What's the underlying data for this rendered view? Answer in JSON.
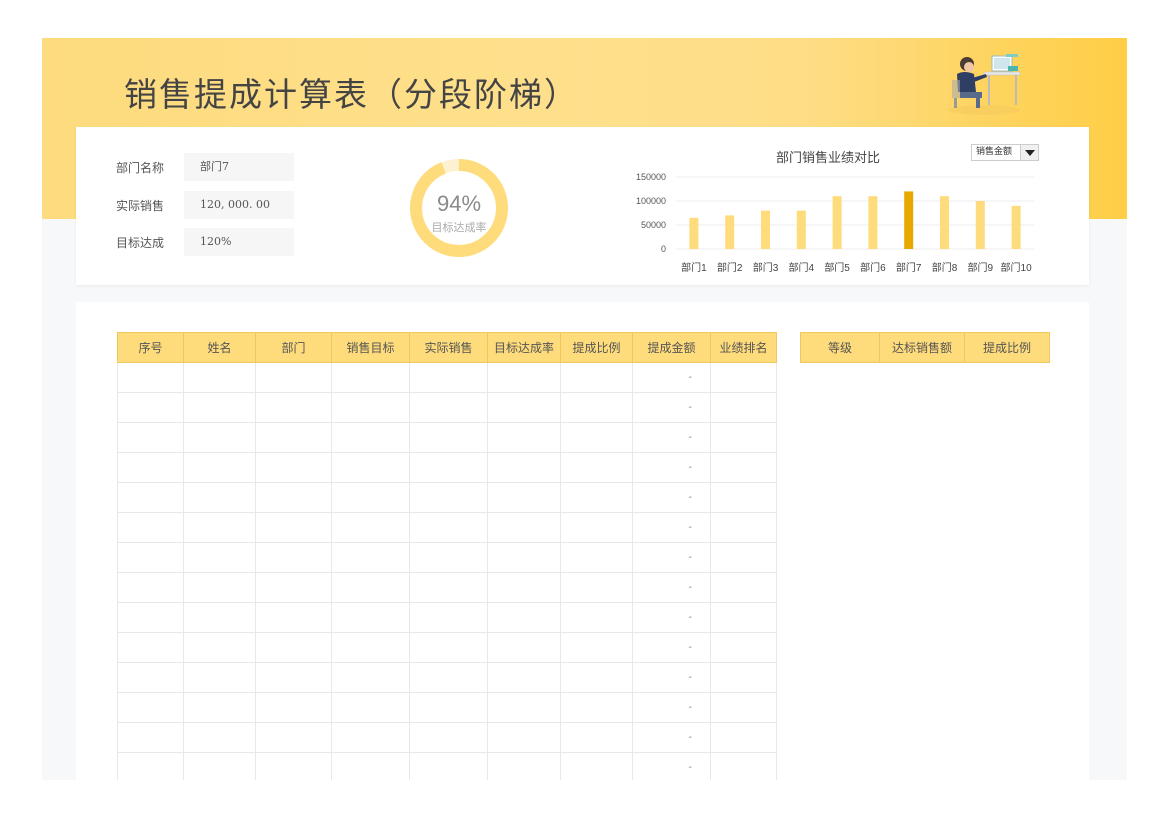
{
  "title": "销售提成计算表（分段阶梯）",
  "colors": {
    "accent": "#fedb7b",
    "bar": "#fedb7b",
    "bar_highlight": "#e8a800",
    "donut": "#fedb7b",
    "donut_rest": "#fdf1d2"
  },
  "info": {
    "dept_label": "部门名称",
    "dept_value": "部门7",
    "sales_label": "实际销售",
    "sales_value": "120, 000. 00",
    "rate_label": "目标达成",
    "rate_value": "120%"
  },
  "donut": {
    "percent_text": "94%",
    "percent_value": 0.94,
    "label": "目标达成率"
  },
  "chart_select": {
    "value": "销售金额"
  },
  "chart_data": {
    "type": "bar",
    "title": "部门销售业绩对比",
    "categories": [
      "部门1",
      "部门2",
      "部门3",
      "部门4",
      "部门5",
      "部门6",
      "部门7",
      "部门8",
      "部门9",
      "部门10"
    ],
    "values": [
      65000,
      70000,
      80000,
      80000,
      110000,
      110000,
      120000,
      110000,
      100000,
      90000
    ],
    "highlight": "部门7",
    "ylim": [
      0,
      150000
    ],
    "yticks": [
      "150000",
      "100000",
      "50000",
      "0"
    ],
    "xlabel": "",
    "ylabel": "",
    "grid": true
  },
  "main_table": {
    "headers": [
      "序号",
      "姓名",
      "部门",
      "销售目标",
      "实际销售",
      "目标达成率",
      "提成比例",
      "提成金额",
      "业绩排名"
    ],
    "rows": [
      [
        "",
        "",
        "",
        "",
        "",
        "",
        "",
        "-",
        ""
      ],
      [
        "",
        "",
        "",
        "",
        "",
        "",
        "",
        "-",
        ""
      ],
      [
        "",
        "",
        "",
        "",
        "",
        "",
        "",
        "-",
        ""
      ],
      [
        "",
        "",
        "",
        "",
        "",
        "",
        "",
        "-",
        ""
      ],
      [
        "",
        "",
        "",
        "",
        "",
        "",
        "",
        "-",
        ""
      ],
      [
        "",
        "",
        "",
        "",
        "",
        "",
        "",
        "-",
        ""
      ],
      [
        "",
        "",
        "",
        "",
        "",
        "",
        "",
        "-",
        ""
      ],
      [
        "",
        "",
        "",
        "",
        "",
        "",
        "",
        "-",
        ""
      ],
      [
        "",
        "",
        "",
        "",
        "",
        "",
        "",
        "-",
        ""
      ],
      [
        "",
        "",
        "",
        "",
        "",
        "",
        "",
        "-",
        ""
      ],
      [
        "",
        "",
        "",
        "",
        "",
        "",
        "",
        "-",
        ""
      ],
      [
        "",
        "",
        "",
        "",
        "",
        "",
        "",
        "-",
        ""
      ],
      [
        "",
        "",
        "",
        "",
        "",
        "",
        "",
        "-",
        ""
      ],
      [
        "",
        "",
        "",
        "",
        "",
        "",
        "",
        "-",
        ""
      ]
    ]
  },
  "side_table": {
    "headers": [
      "等级",
      "达标销售额",
      "提成比例"
    ]
  }
}
